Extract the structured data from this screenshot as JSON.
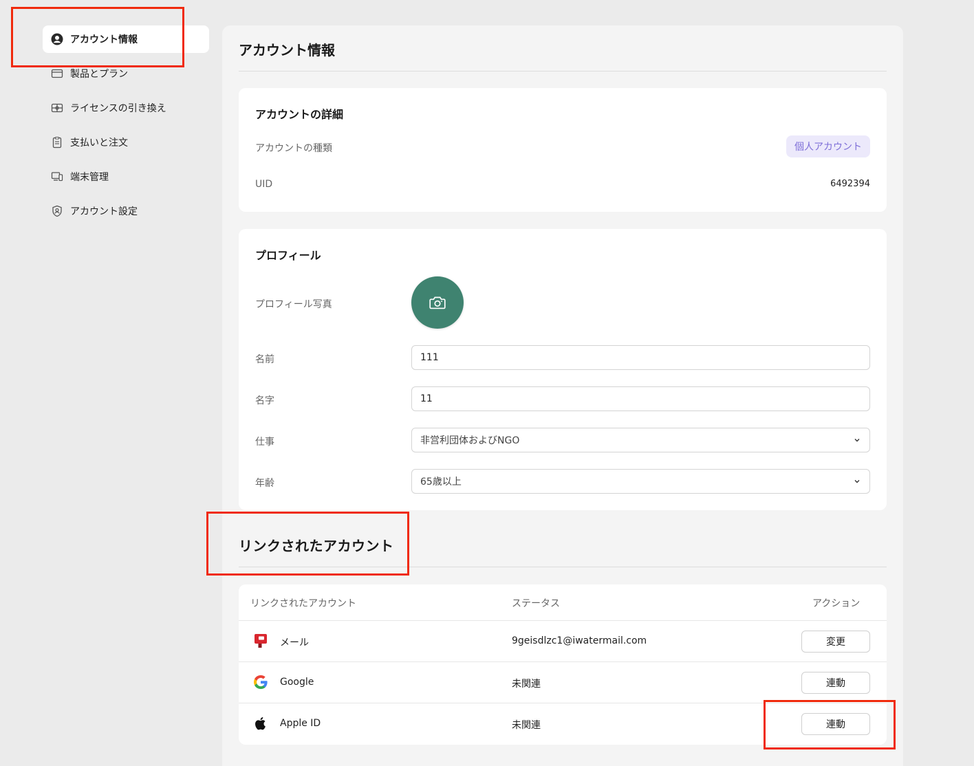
{
  "sidebar": {
    "items": [
      {
        "label": "アカウント情報",
        "icon": "user-circle-icon",
        "active": true
      },
      {
        "label": "製品とプラン",
        "icon": "card-icon"
      },
      {
        "label": "ライセンスの引き換え",
        "icon": "gift-icon"
      },
      {
        "label": "支払いと注文",
        "icon": "clipboard-icon"
      },
      {
        "label": "端末管理",
        "icon": "devices-icon"
      },
      {
        "label": "アカウント設定",
        "icon": "shield-user-icon"
      }
    ]
  },
  "main": {
    "title": "アカウント情報",
    "details": {
      "title": "アカウントの詳細",
      "type_label": "アカウントの種類",
      "type_value": "個人アカウント",
      "uid_label": "UID",
      "uid_value": "6492394"
    },
    "profile": {
      "title": "プロフィール",
      "photo_label": "プロフィール写真",
      "first_name_label": "名前",
      "first_name_value": "111",
      "last_name_label": "名字",
      "last_name_value": "11",
      "job_label": "仕事",
      "job_value": "非営利団体およびNGO",
      "age_label": "年齢",
      "age_value": "65歳以上"
    },
    "linked": {
      "title": "リンクされたアカウント",
      "columns": [
        "リンクされたアカウント",
        "ステータス",
        "アクション"
      ],
      "rows": [
        {
          "name": "メール",
          "icon": "mail-icon",
          "status": "9geisdlzc1@iwatermail.com",
          "action": "変更"
        },
        {
          "name": "Google",
          "icon": "google-icon",
          "status": "未関連",
          "action": "連動"
        },
        {
          "name": "Apple ID",
          "icon": "apple-icon",
          "status": "未関連",
          "action": "連動"
        }
      ]
    }
  },
  "colors": {
    "accent_green": "#3f8370",
    "badge_bg": "#ece9fb",
    "badge_text": "#7e6fd8",
    "highlight": "#f02a0c"
  }
}
